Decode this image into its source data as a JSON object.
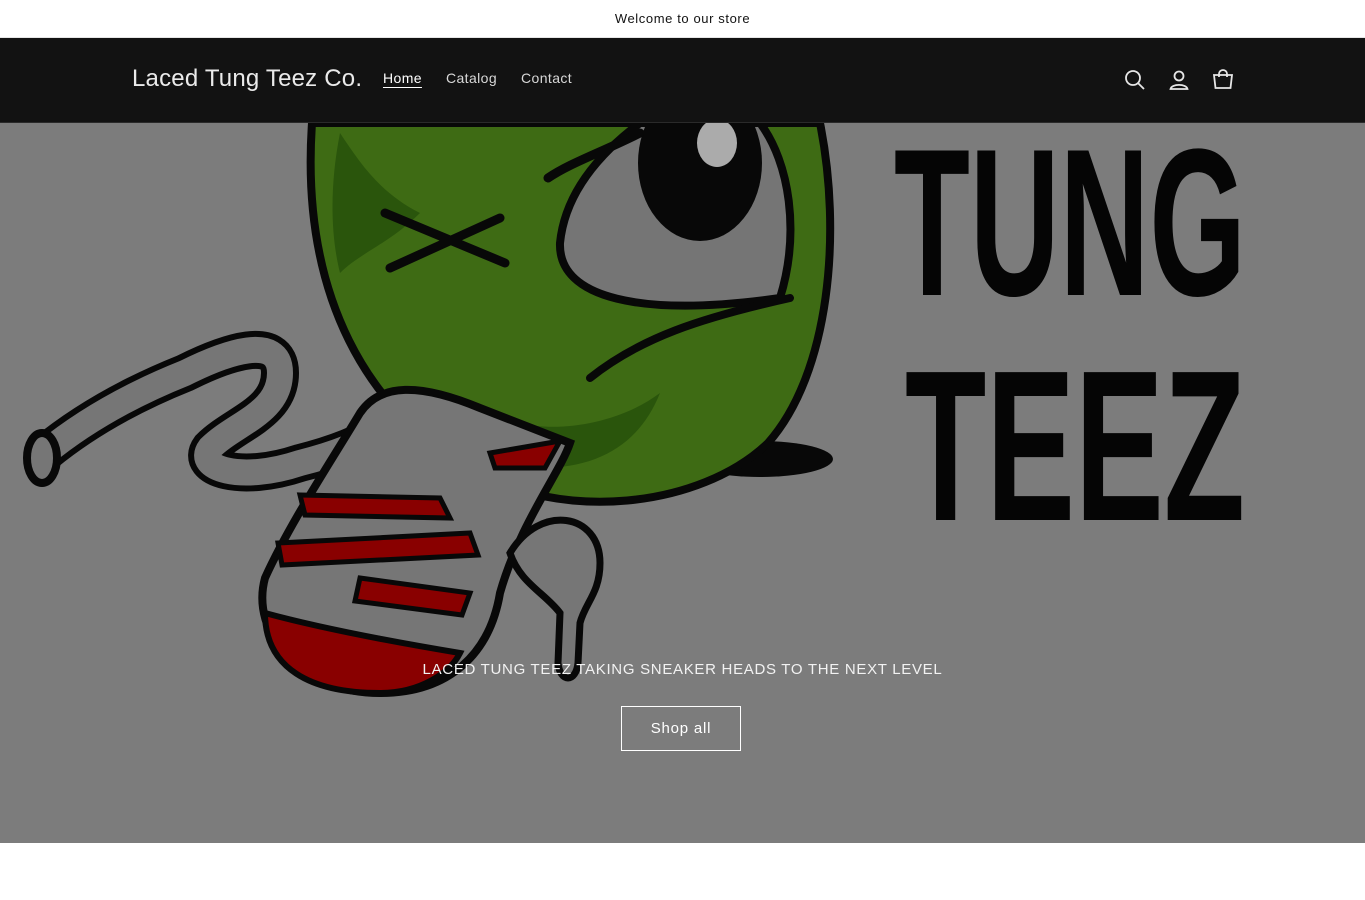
{
  "announcement": {
    "text": "Welcome to our store"
  },
  "header": {
    "store_name": "Laced Tung Teez Co.",
    "nav": [
      {
        "label": "Home",
        "active": true
      },
      {
        "label": "Catalog",
        "active": false
      },
      {
        "label": "Contact",
        "active": false
      }
    ],
    "icons": [
      "search-icon",
      "account-icon",
      "cart-icon"
    ]
  },
  "hero": {
    "image_text_line1": "TUNG",
    "image_text_line2": "TEEZ",
    "heading": "LACED TUNG TEEZ TAKING SNEAKER HEADS TO THE NEXT LEVEL",
    "button_label": "Shop all"
  },
  "colors": {
    "header_bg": "#121212",
    "hero_bg": "#b2b2b2",
    "mascot_green": "#5a9a1e",
    "lace_red": "#c40000"
  }
}
